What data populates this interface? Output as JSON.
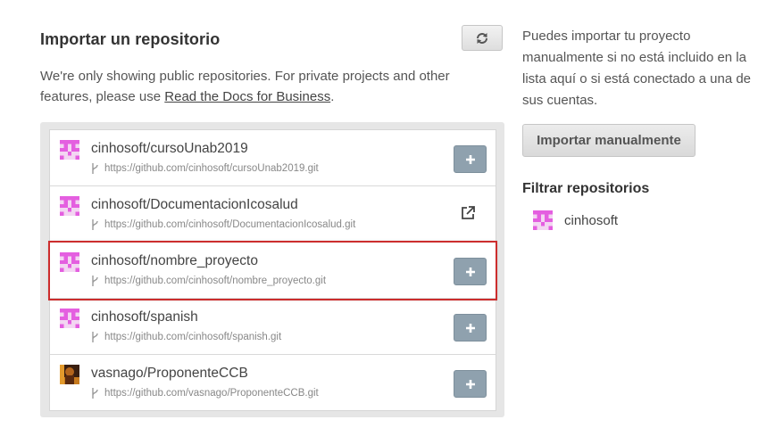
{
  "header": {
    "title": "Importar un repositorio",
    "refresh_icon": "refresh-icon"
  },
  "notice": {
    "text_before": "We're only showing public repositories. For private projects and other features, please use ",
    "link": "Read the Docs for Business",
    "text_after": "."
  },
  "repos": [
    {
      "name": "cinhosoft/cursoUnab2019",
      "url": "https://github.com/cinhosoft/cursoUnab2019.git",
      "action": "add",
      "avatar": "identicon-pink"
    },
    {
      "name": "cinhosoft/DocumentacionIcosalud",
      "url": "https://github.com/cinhosoft/DocumentacionIcosalud.git",
      "action": "external-link",
      "avatar": "identicon-pink"
    },
    {
      "name": "cinhosoft/nombre_proyecto",
      "url": "https://github.com/cinhosoft/nombre_proyecto.git",
      "action": "add",
      "avatar": "identicon-pink",
      "highlighted": true
    },
    {
      "name": "cinhosoft/spanish",
      "url": "https://github.com/cinhosoft/spanish.git",
      "action": "add",
      "avatar": "identicon-pink"
    },
    {
      "name": "vasnago/ProponenteCCB",
      "url": "https://github.com/vasnago/ProponenteCCB.git",
      "action": "add",
      "avatar": "photo-avatar"
    }
  ],
  "sidebar": {
    "help_text": "Puedes importar tu proyecto manualmente si no está incluido en la lista aquí o si está conectado a una de sus cuentas.",
    "manual_button": "Importar manualmente",
    "filter_title": "Filtrar repositorios",
    "filter_items": [
      {
        "label": "cinhosoft",
        "avatar": "identicon-pink"
      }
    ]
  },
  "colors": {
    "identicon": "#e45fe0",
    "add_button": "#8fa1ae",
    "highlight": "#cc2d2d"
  }
}
